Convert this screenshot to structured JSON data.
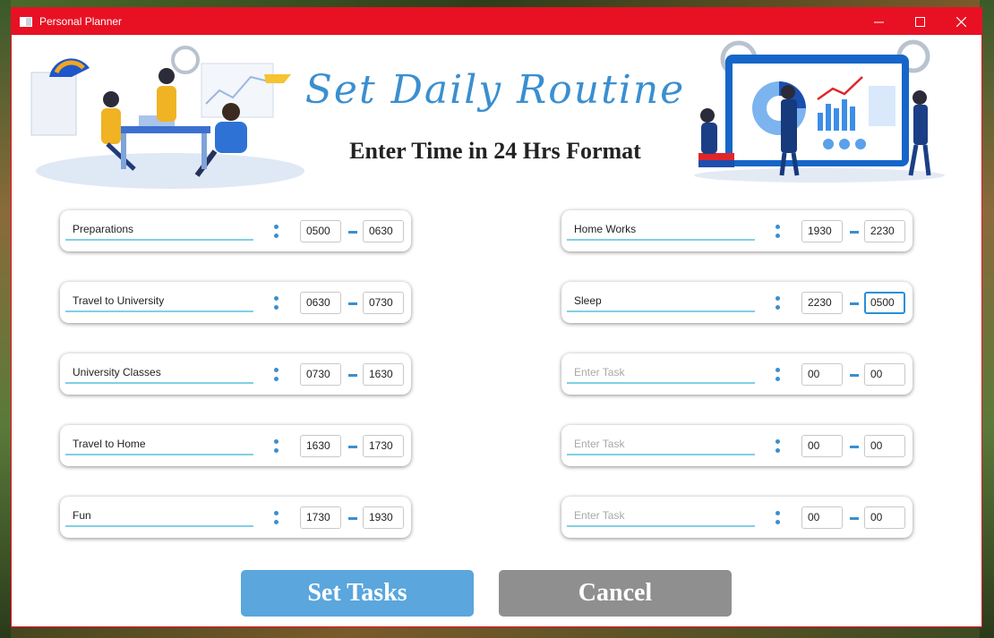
{
  "window": {
    "title": "Personal Planner"
  },
  "header": {
    "title": "Set Daily Routine",
    "subtitle": "Enter Time in 24 Hrs Format"
  },
  "tasks_left": [
    {
      "name": "Preparations",
      "start": "0500",
      "end": "0630"
    },
    {
      "name": "Travel to University",
      "start": "0630",
      "end": "0730"
    },
    {
      "name": "University Classes",
      "start": "0730",
      "end": "1630"
    },
    {
      "name": "Travel to Home",
      "start": "1630",
      "end": "1730"
    },
    {
      "name": "Fun",
      "start": "1730",
      "end": "1930"
    }
  ],
  "tasks_right": [
    {
      "name": "Home Works",
      "start": "1930",
      "end": "2230"
    },
    {
      "name": "Sleep",
      "start": "2230",
      "end": "0500"
    },
    {
      "name": "Enter Task",
      "start": "00",
      "end": "00"
    },
    {
      "name": "Enter Task",
      "start": "00",
      "end": "00"
    },
    {
      "name": "Enter Task",
      "start": "00",
      "end": "00"
    }
  ],
  "buttons": {
    "set": "Set Tasks",
    "cancel": "Cancel"
  },
  "colors": {
    "titlebar": "#e81123",
    "accent": "#3a8fd0",
    "set_button": "#5aa6dd",
    "cancel_button": "#8f8f8f"
  }
}
